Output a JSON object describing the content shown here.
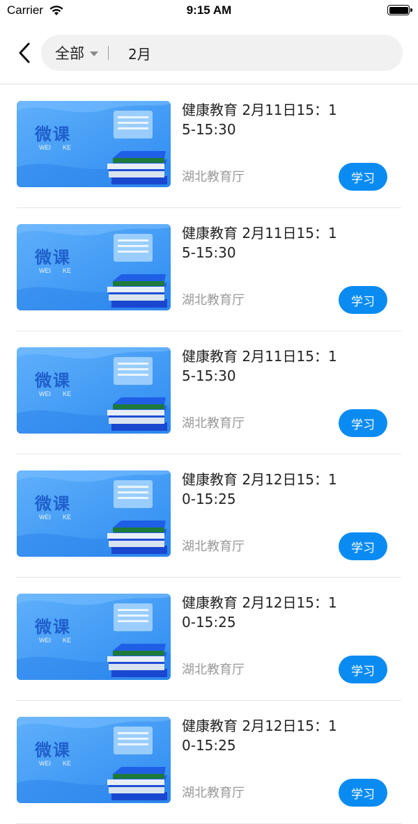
{
  "status_bar": {
    "carrier": "Carrier",
    "time": "9:15 AM"
  },
  "nav": {
    "filter_label": "全部",
    "search_value": "2月"
  },
  "thumbnail": {
    "title": "微课",
    "subtitle_left": "WEI",
    "subtitle_right": "KE"
  },
  "courses": [
    {
      "title": "健康教育 2月11日15：15-15:30",
      "source": "湖北教育厅",
      "button": "学习"
    },
    {
      "title": "健康教育 2月11日15：15-15:30",
      "source": "湖北教育厅",
      "button": "学习"
    },
    {
      "title": "健康教育 2月11日15：15-15:30",
      "source": "湖北教育厅",
      "button": "学习"
    },
    {
      "title": "健康教育 2月12日15：10-15:25",
      "source": "湖北教育厅",
      "button": "学习"
    },
    {
      "title": "健康教育 2月12日15：10-15:25",
      "source": "湖北教育厅",
      "button": "学习"
    },
    {
      "title": "健康教育 2月12日15：10-15:25",
      "source": "湖北教育厅",
      "button": "学习"
    }
  ],
  "colors": {
    "accent": "#0a8bf2",
    "thumb_bg": "#3a9af2"
  }
}
